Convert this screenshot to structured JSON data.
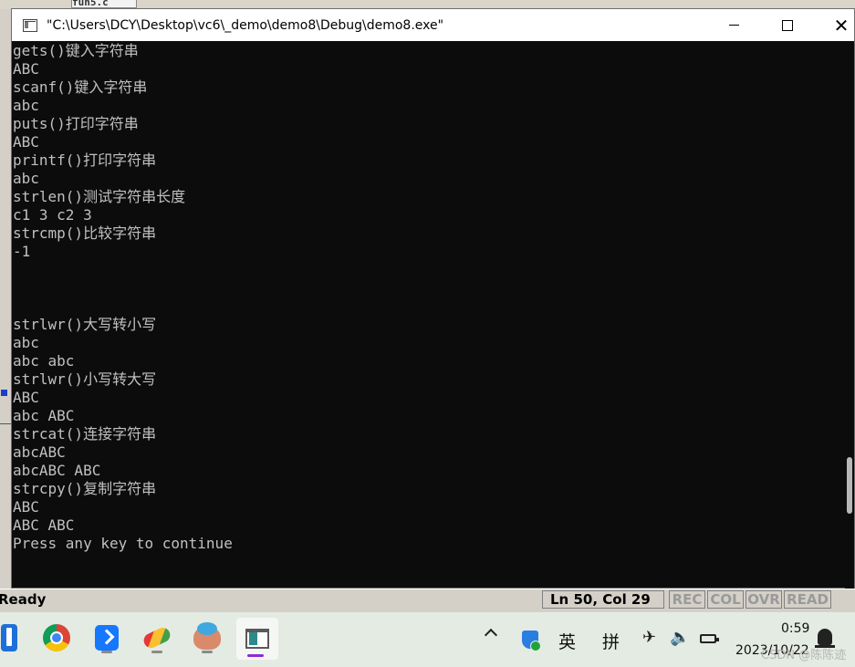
{
  "background": {
    "file_tab": "fun5.c"
  },
  "console": {
    "title": "\"C:\\Users\\DCY\\Desktop\\vc6\\_demo\\demo8\\Debug\\demo8.exe\"",
    "lines": [
      "gets()键入字符串",
      "ABC",
      "scanf()键入字符串",
      "abc",
      "puts()打印字符串",
      "ABC",
      "printf()打印字符串",
      "abc",
      "strlen()测试字符串长度",
      "c1 3 c2 3",
      "strcmp()比较字符串",
      "-1",
      "",
      "",
      "",
      "strlwr()大写转小写",
      "abc",
      "abc abc",
      "strlwr()小写转大写",
      "ABC",
      "abc ABC",
      "strcat()连接字符串",
      "abcABC",
      "abcABC ABC",
      "strcpy()复制字符串",
      "ABC",
      "ABC ABC",
      "Press any key to continue"
    ]
  },
  "ide_status": {
    "ready": "Ready",
    "position": "Ln 50, Col 29",
    "rec": "REC",
    "col": "COL",
    "ovr": "OVR",
    "read": "READ"
  },
  "taskbar": {
    "ime_lang": "英",
    "ime_mode": "拼",
    "time": "0:59",
    "date": "2023/10/22",
    "watermark": "CSDN @陈陈迹"
  },
  "colors": {
    "console_bg": "#0c0c0c",
    "console_text": "#c0c0c0",
    "titlebar_bg": "#ffffff",
    "taskbar_bg": "#e4ebe2",
    "active_indicator": "#8e2bd6"
  }
}
